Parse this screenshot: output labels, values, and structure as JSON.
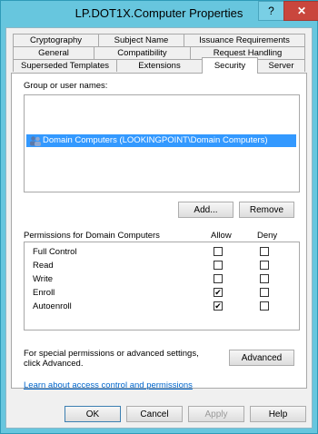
{
  "window": {
    "title": "LP.DOT1X.Computer Properties",
    "help_label": "?",
    "close_label": "✕"
  },
  "tabs": {
    "row1": [
      "Cryptography",
      "Subject Name",
      "Issuance Requirements"
    ],
    "row2": [
      "General",
      "Compatibility",
      "Request Handling"
    ],
    "row3": [
      "Superseded Templates",
      "Extensions",
      "Security",
      "Server"
    ],
    "active": "Security"
  },
  "security": {
    "group_label": "Group or user names:",
    "selected_entry": "Domain Computers (LOOKINGPOINT\\Domain Computers)",
    "add_label": "Add...",
    "remove_label": "Remove",
    "permissions_label": "Permissions for Domain Computers",
    "allow_header": "Allow",
    "deny_header": "Deny",
    "permissions": [
      {
        "name": "Full Control",
        "allow": false,
        "deny": false
      },
      {
        "name": "Read",
        "allow": false,
        "deny": false
      },
      {
        "name": "Write",
        "allow": false,
        "deny": false
      },
      {
        "name": "Enroll",
        "allow": true,
        "deny": false
      },
      {
        "name": "Autoenroll",
        "allow": true,
        "deny": false
      }
    ],
    "special_text": "For special permissions or advanced settings, click Advanced.",
    "advanced_label": "Advanced",
    "learn_link": "Learn about access control and permissions"
  },
  "footer": {
    "ok": "OK",
    "cancel": "Cancel",
    "apply": "Apply",
    "help": "Help"
  }
}
